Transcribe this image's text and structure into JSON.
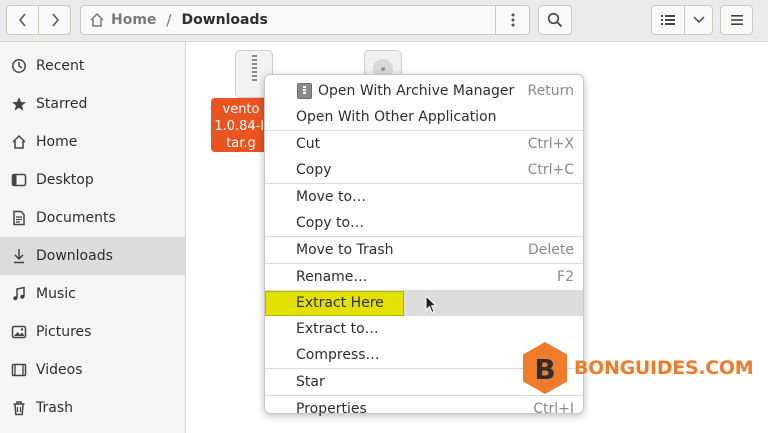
{
  "header": {
    "path_home": "Home",
    "path_current": "Downloads"
  },
  "sidebar": {
    "items": [
      {
        "label": "Recent",
        "icon": "clock-icon"
      },
      {
        "label": "Starred",
        "icon": "star-icon"
      },
      {
        "label": "Home",
        "icon": "home-icon"
      },
      {
        "label": "Desktop",
        "icon": "desktop-icon"
      },
      {
        "label": "Documents",
        "icon": "document-icon"
      },
      {
        "label": "Downloads",
        "icon": "download-icon",
        "active": true
      },
      {
        "label": "Music",
        "icon": "music-icon"
      },
      {
        "label": "Pictures",
        "icon": "picture-icon"
      },
      {
        "label": "Videos",
        "icon": "video-icon"
      },
      {
        "label": "Trash",
        "icon": "trash-icon"
      }
    ]
  },
  "content": {
    "selected_file_label": "vento\n1.0.84-li\ntar.g"
  },
  "context_menu": {
    "items": [
      {
        "label": "Open With Archive Manager",
        "accel": "Return"
      },
      {
        "label": "Open With Other Application",
        "accel": ""
      },
      {
        "label": "Cut",
        "accel": "Ctrl+X"
      },
      {
        "label": "Copy",
        "accel": "Ctrl+C"
      },
      {
        "label": "Move to…",
        "accel": ""
      },
      {
        "label": "Copy to…",
        "accel": ""
      },
      {
        "label": "Move to Trash",
        "accel": "Delete"
      },
      {
        "label": "Rename…",
        "accel": "F2"
      },
      {
        "label": "Extract Here",
        "accel": ""
      },
      {
        "label": "Extract to…",
        "accel": ""
      },
      {
        "label": "Compress…",
        "accel": ""
      },
      {
        "label": "Star",
        "accel": ""
      },
      {
        "label": "Properties",
        "accel": "Ctrl+I"
      }
    ]
  },
  "watermark": {
    "text": "BONGUIDES.COM",
    "letter": "B",
    "color": "#ef7c2a"
  },
  "colors": {
    "selection": "#e95420",
    "highlight": "#e2e000"
  }
}
